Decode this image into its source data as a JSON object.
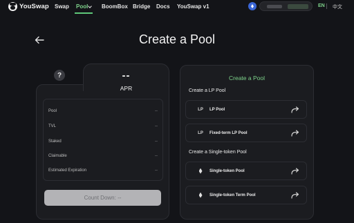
{
  "header": {
    "logo_text": "YouSwap",
    "nav": [
      {
        "label": "Swap"
      },
      {
        "label": "Pool"
      },
      {
        "label": "BoomBox"
      },
      {
        "label": "Bridge"
      },
      {
        "label": "Docs"
      },
      {
        "label": "YouSwap v1"
      }
    ],
    "lang_en": "EN",
    "lang_zh": "中文",
    "accent_color": "#7fd48c"
  },
  "page": {
    "title": "Create a Pool"
  },
  "left_card": {
    "help_badge": "?",
    "apr_value": "--",
    "apr_label": "APR",
    "stats": [
      {
        "label": "Pool",
        "value": "--"
      },
      {
        "label": "TVL",
        "value": "--"
      },
      {
        "label": "Staked",
        "value": "--"
      },
      {
        "label": "Claimable",
        "value": "--"
      },
      {
        "label": "Estimated Expiration",
        "value": "--"
      }
    ],
    "countdown_label": "Count Down: --"
  },
  "right_card": {
    "title": "Create a Pool",
    "lp_section_title": "Create a LP Pool",
    "single_section_title": "Create a Single-token Pool",
    "lp_items": [
      {
        "icon_text": "LP",
        "label": "LP Pool"
      },
      {
        "icon_text": "LP",
        "label": "Fixed-term LP Pool"
      }
    ],
    "single_items": [
      {
        "icon": "eth-icon",
        "label": "Single-token Pool"
      },
      {
        "icon": "eth-icon",
        "label": "Single-token Term Pool"
      }
    ]
  }
}
